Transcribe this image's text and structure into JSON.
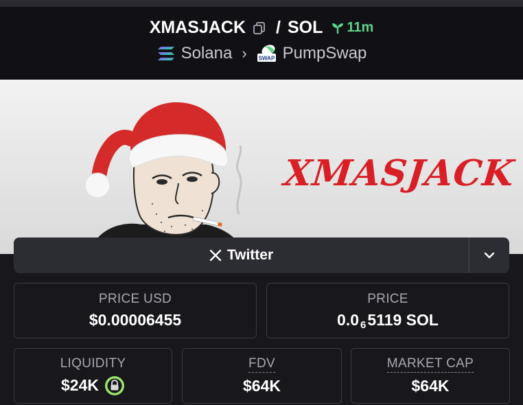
{
  "header": {
    "base_symbol": "XMASJACK",
    "separator": "/",
    "quote_symbol": "SOL",
    "age": "11m",
    "chain": "Solana",
    "dex": "PumpSwap",
    "dex_logo_text": "SWAP",
    "icons": {
      "copy": "copy-icon",
      "age": "sprout-icon",
      "chain": "solana-logo-icon",
      "dex": "pumpswap-logo-icon",
      "chevron": "chevron-right-icon"
    },
    "colors": {
      "age": "#5fd38a"
    }
  },
  "banner": {
    "title": "XMASJACK",
    "colors": {
      "title": "#d81f26",
      "hat": "#d42a2a"
    }
  },
  "twitter": {
    "label": "Twitter",
    "icons": {
      "x": "x-logo-icon",
      "dropdown": "chevron-down-icon"
    }
  },
  "stats": {
    "price_usd": {
      "label": "PRICE USD",
      "value": "$0.00006455"
    },
    "price": {
      "label": "PRICE",
      "value_prefix": "0.0",
      "value_sub": "6",
      "value_rest": "5119 SOL"
    },
    "liquidity": {
      "label": "LIQUIDITY",
      "value": "$24K",
      "icon": "lock-icon",
      "icon_color": "#9be36b"
    },
    "fdv": {
      "label": "FDV",
      "value": "$64K"
    },
    "market_cap": {
      "label": "MARKET CAP",
      "value": "$64K"
    }
  }
}
